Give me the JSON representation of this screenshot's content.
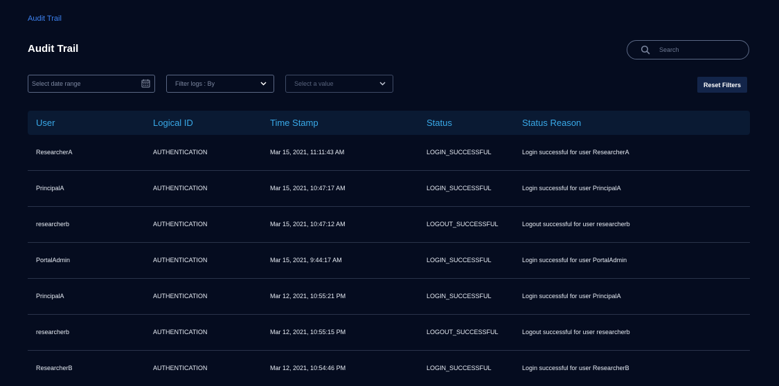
{
  "breadcrumb": "Audit Trail",
  "page_title": "Audit Trail",
  "search": {
    "placeholder": "Search"
  },
  "filters": {
    "date_range_placeholder": "Select date range",
    "filter_logs_placeholder": "Filter logs : By",
    "value_placeholder": "Select a value",
    "reset_label": "Reset Filters"
  },
  "table": {
    "columns": [
      "User",
      "Logical ID",
      "Time Stamp",
      "Status",
      "Status Reason"
    ],
    "rows": [
      [
        "ResearcherA",
        "AUTHENTICATION",
        "Mar 15, 2021, 11:11:43 AM",
        "LOGIN_SUCCESSFUL",
        "Login successful for user ResearcherA"
      ],
      [
        "PrincipalA",
        "AUTHENTICATION",
        "Mar 15, 2021, 10:47:17 AM",
        "LOGIN_SUCCESSFUL",
        "Login successful for user PrincipalA"
      ],
      [
        "researcherb",
        "AUTHENTICATION",
        "Mar 15, 2021, 10:47:12 AM",
        "LOGOUT_SUCCESSFUL",
        "Logout successful for user researcherb"
      ],
      [
        "PortalAdmin",
        "AUTHENTICATION",
        "Mar 15, 2021, 9:44:17 AM",
        "LOGIN_SUCCESSFUL",
        "Login successful for user PortalAdmin"
      ],
      [
        "PrincipalA",
        "AUTHENTICATION",
        "Mar 12, 2021, 10:55:21 PM",
        "LOGIN_SUCCESSFUL",
        "Login successful for user PrincipalA"
      ],
      [
        "researcherb",
        "AUTHENTICATION",
        "Mar 12, 2021, 10:55:15 PM",
        "LOGOUT_SUCCESSFUL",
        "Logout successful for user researcherb"
      ],
      [
        "ResearcherB",
        "AUTHENTICATION",
        "Mar 12, 2021, 10:54:46 PM",
        "LOGIN_SUCCESSFUL",
        "Login successful for user ResearcherB"
      ]
    ]
  },
  "icons": {
    "search": "search-icon",
    "calendar": "calendar-icon",
    "dropdown": "chevron-down-icon"
  },
  "colors": {
    "background": "#050c1f",
    "accent": "#39a9e8",
    "link": "#3d82f0",
    "button": "#13254a"
  }
}
